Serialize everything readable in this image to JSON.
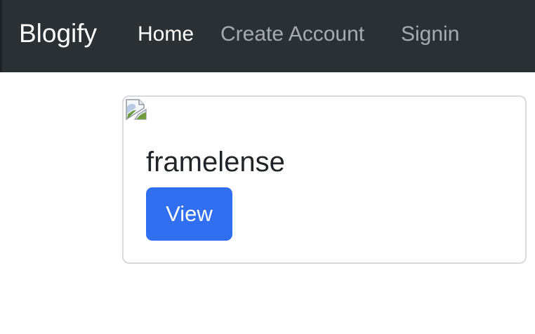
{
  "navbar": {
    "brand": "Blogify",
    "links": [
      {
        "label": "Home",
        "active": true
      },
      {
        "label": "Create Account",
        "active": false
      },
      {
        "label": "Signin",
        "active": false
      }
    ]
  },
  "cards": [
    {
      "title": "framelense",
      "button_label": "View",
      "image_state": "broken-image-icon"
    }
  ],
  "colors": {
    "navbar_bg": "#2b3035",
    "nav_active": "#ffffff",
    "nav_inactive": "#a7abb0",
    "button_bg": "#2f6ff0",
    "card_border": "#d8dadd"
  }
}
